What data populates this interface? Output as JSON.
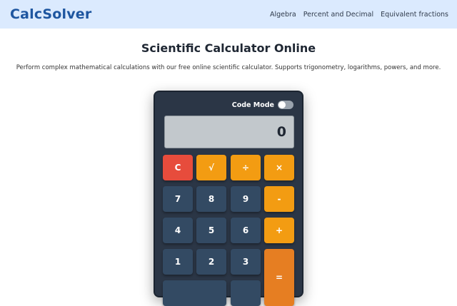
{
  "header": {
    "logo": "CalcSolver",
    "nav": [
      "Algebra",
      "Percent and Decimal",
      "Equivalent fractions"
    ]
  },
  "page": {
    "title": "Scientific Calculator Online",
    "subtitle": "Perform complex mathematical calculations with our free online scientific calculator. Supports trigonometry, logarithms, powers, and more."
  },
  "calculator": {
    "code_mode_label": "Code Mode",
    "code_mode_on": false,
    "display": "0",
    "keys": {
      "clear": "C",
      "sqrt": "√",
      "divide": "÷",
      "multiply": "×",
      "seven": "7",
      "eight": "8",
      "nine": "9",
      "minus": "-",
      "four": "4",
      "five": "5",
      "six": "6",
      "plus": "+",
      "one": "1",
      "two": "2",
      "three": "3",
      "equals": "="
    }
  },
  "colors": {
    "header_bg": "#dbeafe",
    "brand": "#1e56a0",
    "calc_body": "#2b3646",
    "number_key": "#334a63",
    "operator_key": "#f39c12",
    "clear_key": "#e74c3c",
    "equals_key": "#e67e22"
  }
}
